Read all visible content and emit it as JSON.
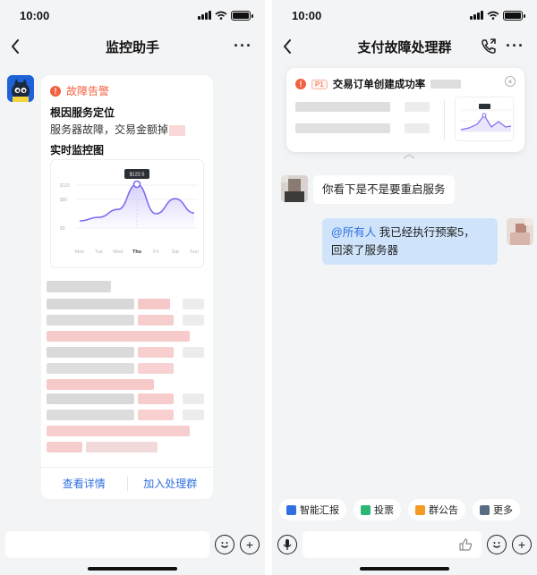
{
  "left": {
    "status_time": "10:00",
    "nav": {
      "title": "监控助手"
    },
    "card": {
      "alert_label": "故障告警",
      "root_cause_title": "根因服务定位",
      "root_cause_text": "服务器故障，交易金额掉",
      "monitor_title": "实时监控图",
      "chart_data": {
        "type": "line",
        "categories": [
          "Mon",
          "Tue",
          "Wed",
          "Thu",
          "Fri",
          "Sat",
          "Sun"
        ],
        "values": [
          20,
          30,
          52,
          122.5,
          40,
          82,
          42
        ],
        "yticks": [
          "$120",
          "$80",
          "$0"
        ],
        "ylim": [
          0,
          140
        ],
        "highlight_index": 3,
        "tooltip": "$122.5",
        "grid": true,
        "line_color": "#7b6cf2"
      },
      "action_detail": "查看详情",
      "action_join": "加入处理群"
    }
  },
  "right": {
    "status_time": "10:00",
    "nav": {
      "title": "支付故障处理群"
    },
    "pin": {
      "priority": "P1",
      "title": "交易订单创建成功率"
    },
    "messages": [
      {
        "text": "你看下是不是要重启服务"
      },
      {
        "mention": "@所有人",
        "text_line1": " 我已经执行预案5，",
        "text_line2": "回滚了服务器"
      }
    ],
    "tools": [
      {
        "label": "智能汇报",
        "icon": "report-icon",
        "color": "#2f6fe0"
      },
      {
        "label": "投票",
        "icon": "vote-icon",
        "color": "#2bb673"
      },
      {
        "label": "群公告",
        "icon": "announcement-icon",
        "color": "#f59a23"
      },
      {
        "label": "更多",
        "icon": "more-icon",
        "color": "#5a6b84"
      }
    ]
  }
}
